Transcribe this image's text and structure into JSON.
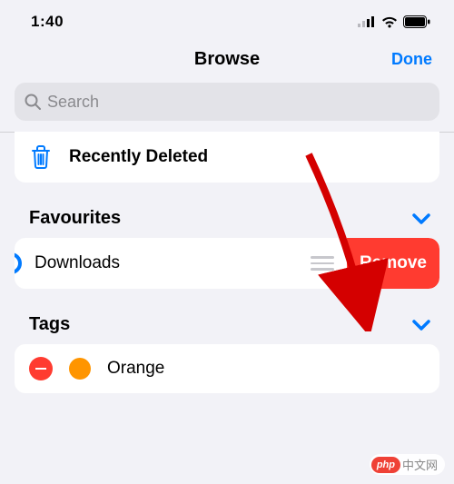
{
  "status": {
    "time": "1:40"
  },
  "nav": {
    "title": "Browse",
    "done": "Done"
  },
  "search": {
    "placeholder": "Search"
  },
  "recently_deleted": {
    "label": "Recently Deleted"
  },
  "sections": {
    "favourites": {
      "title": "Favourites"
    },
    "tags": {
      "title": "Tags"
    }
  },
  "favourites": {
    "item": {
      "label": "Downloads"
    },
    "remove_label": "Remove"
  },
  "tags": {
    "item": {
      "label": "Orange",
      "color": "#ff9500"
    }
  },
  "watermark": {
    "logo": "php",
    "text": "中文网"
  }
}
